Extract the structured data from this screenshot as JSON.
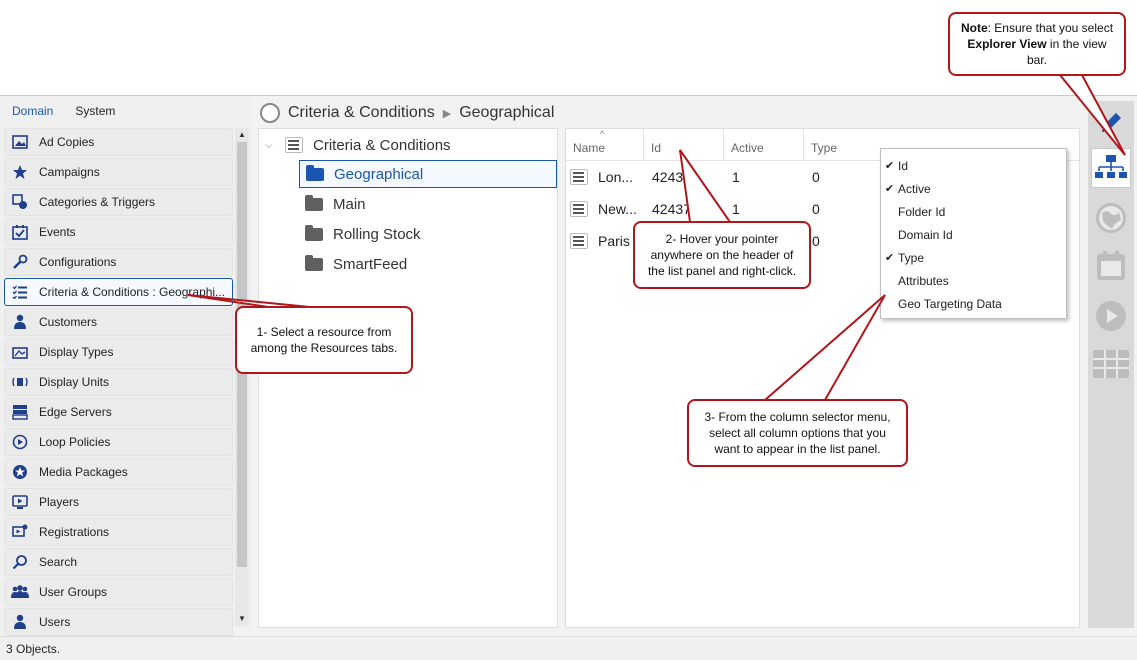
{
  "sidebar": {
    "tabs": [
      {
        "label": "Domain"
      },
      {
        "label": "System"
      }
    ],
    "items": [
      {
        "label": "Ad Copies",
        "icon": "ad-copies-icon"
      },
      {
        "label": "Campaigns",
        "icon": "star-icon"
      },
      {
        "label": "Categories & Triggers",
        "icon": "categories-icon"
      },
      {
        "label": "Events",
        "icon": "calendar-check-icon"
      },
      {
        "label": "Configurations",
        "icon": "wrench-icon"
      },
      {
        "label": "Criteria & Conditions : Geographi...",
        "icon": "checklist-icon"
      },
      {
        "label": "Customers",
        "icon": "customers-icon"
      },
      {
        "label": "Display Types",
        "icon": "display-types-icon"
      },
      {
        "label": "Display Units",
        "icon": "display-units-icon"
      },
      {
        "label": "Edge Servers",
        "icon": "edge-servers-icon"
      },
      {
        "label": "Loop Policies",
        "icon": "loop-icon"
      },
      {
        "label": "Media Packages",
        "icon": "media-packages-icon"
      },
      {
        "label": "Players",
        "icon": "player-icon"
      },
      {
        "label": "Registrations",
        "icon": "registrations-icon"
      },
      {
        "label": "Search",
        "icon": "search-icon"
      },
      {
        "label": "User Groups",
        "icon": "user-groups-icon"
      },
      {
        "label": "Users",
        "icon": "user-icon"
      }
    ]
  },
  "breadcrumb": {
    "root": "Criteria & Conditions",
    "current": "Geographical"
  },
  "tree": {
    "root": "Criteria & Conditions",
    "children": [
      "Geographical",
      "Main",
      "Rolling Stock",
      "SmartFeed"
    ]
  },
  "list": {
    "columns": [
      "Name",
      "Id",
      "Active",
      "Type"
    ],
    "rows": [
      {
        "name": "Lon...",
        "id": "42437",
        "active": "1",
        "type": "0"
      },
      {
        "name": "New...",
        "id": "424376",
        "active": "1",
        "type": "0"
      },
      {
        "name": "Paris",
        "id": "",
        "active": "",
        "type": "0"
      }
    ]
  },
  "context_menu": [
    {
      "label": "Id",
      "checked": true
    },
    {
      "label": "Active",
      "checked": true
    },
    {
      "label": "Folder Id",
      "checked": false
    },
    {
      "label": "Domain Id",
      "checked": false
    },
    {
      "label": "Type",
      "checked": true
    },
    {
      "label": "Attributes",
      "checked": false
    },
    {
      "label": "Geo Targeting Data",
      "checked": false
    }
  ],
  "status": {
    "text": "3 Objects."
  },
  "callouts": {
    "note_bold": "Note",
    "note_text1": ": Ensure that you select",
    "note_bold2": "Explorer View",
    "note_text2": " in the view bar.",
    "c1": "1- Select a resource from among the Resources tabs.",
    "c2": "2- Hover your pointer anywhere on the header of the list panel and right-click.",
    "c3": "3- From the column selector menu, select all column options that you want to appear in the list panel."
  },
  "colors": {
    "accent": "#1a56b0",
    "callout_border": "#b0161b"
  }
}
